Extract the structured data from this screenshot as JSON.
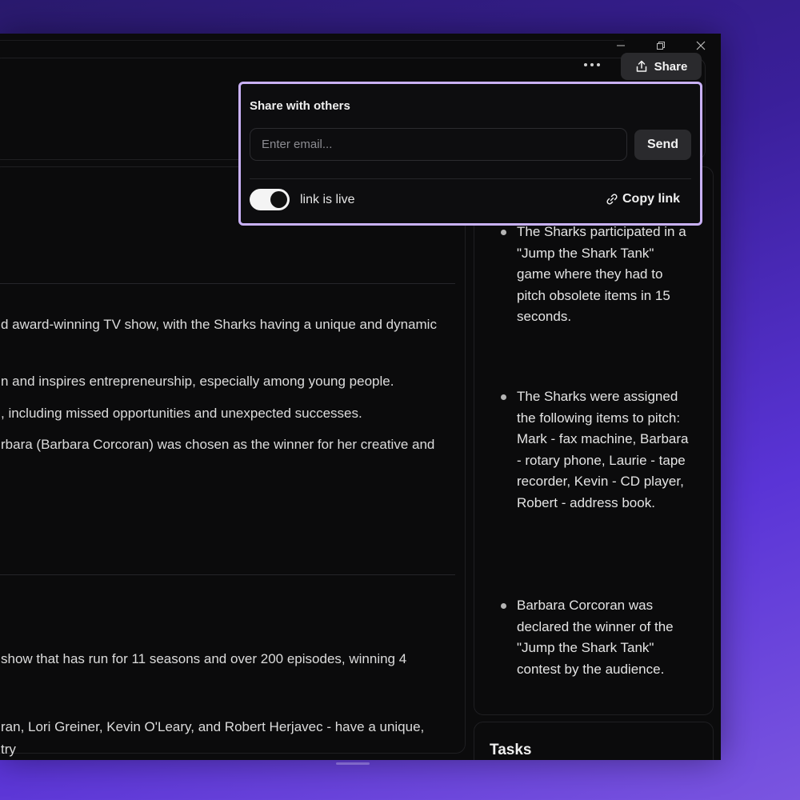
{
  "header": {
    "more_label": "More options",
    "share_label": "Share"
  },
  "share_popup": {
    "title": "Share with others",
    "email_placeholder": "Enter email...",
    "email_value": "",
    "send_label": "Send",
    "link_toggle_label": "link is live",
    "link_toggle_on": true,
    "copy_link_label": "Copy link"
  },
  "main": {
    "paragraphs": [
      "d award-winning TV show, with the Sharks having a unique and dynamic",
      "n and inspires entrepreneurship, especially among young people.",
      ", including missed opportunities and unexpected successes.",
      "rbara (Barbara Corcoran) was chosen as the winner for her creative and",
      "show that has run for 11 seasons and over 200 episodes, winning 4",
      "ran, Lori Greiner, Kevin O'Leary, and Robert Herjavec - have a unique,",
      "try"
    ]
  },
  "sidebar": {
    "bullets": [
      "The Sharks participated in a \"Jump the Shark Tank\" game where they had to pitch obsolete items in 15 seconds.",
      "The Sharks were assigned the following items to pitch: Mark - fax machine, Barbara - rotary phone, Laurie - tape recorder, Kevin - CD player, Robert - address book.",
      "Barbara Corcoran was declared the winner of the \"Jump the Shark Tank\" contest by the audience."
    ],
    "tasks_title": "Tasks"
  }
}
